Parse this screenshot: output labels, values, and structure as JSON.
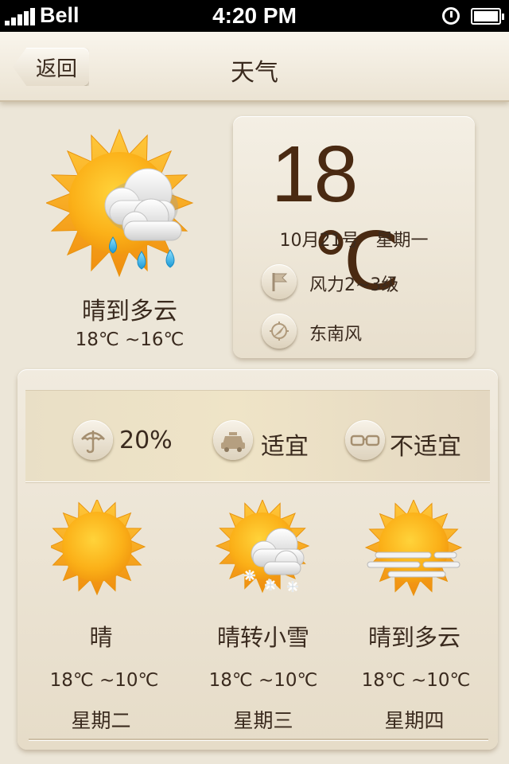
{
  "status": {
    "carrier": "Bell",
    "time": "4:20 PM"
  },
  "nav": {
    "back_label": "返回",
    "title": "天气"
  },
  "today": {
    "icon": "sun-cloud-rain-icon",
    "condition": "晴到多云",
    "range": "18℃ ~16℃",
    "temp_value": "18",
    "temp_unit": "℃",
    "date": "10月21号",
    "weekday": "星期一",
    "wind_force": "风力2~3级",
    "wind_direction": "东南风"
  },
  "indices": [
    {
      "icon": "umbrella-icon",
      "label": "20%"
    },
    {
      "icon": "car-icon",
      "label": "适宜"
    },
    {
      "icon": "glasses-icon",
      "label": "不适宜"
    }
  ],
  "forecast": [
    {
      "icon": "sun-icon",
      "condition": "晴",
      "range": "18℃ ~10℃",
      "day": "星期二"
    },
    {
      "icon": "sun-cloud-snow-icon",
      "condition": "晴转小雪",
      "range": "18℃ ~10℃",
      "day": "星期三"
    },
    {
      "icon": "sun-haze-icon",
      "condition": "晴到多云",
      "range": "18℃ ~10℃",
      "day": "星期四"
    }
  ],
  "colors": {
    "sun": "#fbb018",
    "sun_ray": "#f6a418",
    "text": "#3a2a1e",
    "temp": "#4a2a12",
    "rain": "#3eb4e8",
    "background": "#ece6d8"
  }
}
